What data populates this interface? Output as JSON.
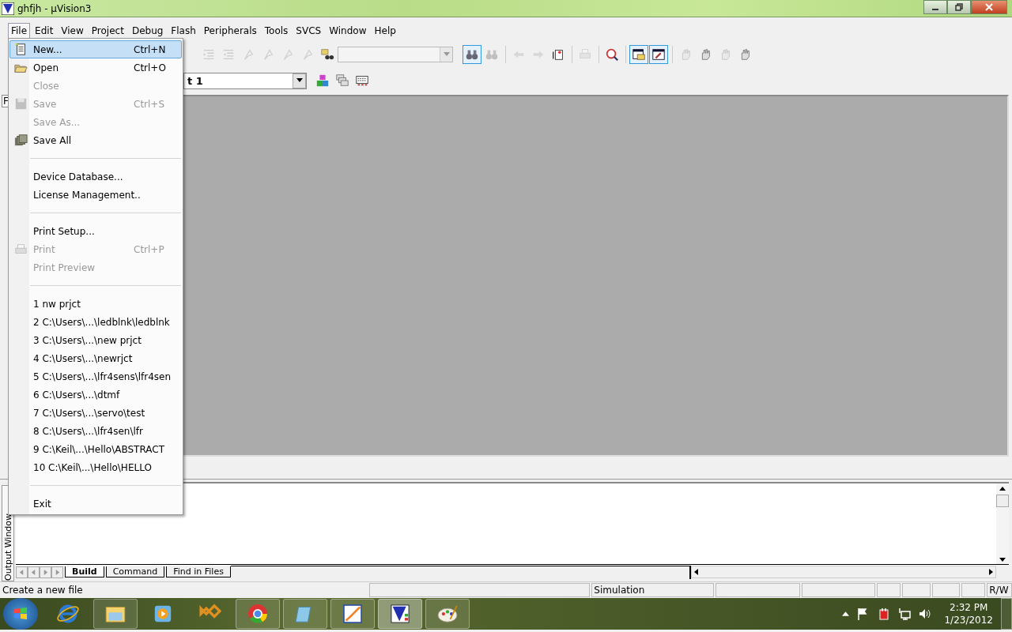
{
  "window": {
    "title": "ghfjh  - µVision3"
  },
  "menubar": [
    {
      "label": "File",
      "selected": true
    },
    {
      "label": "Edit",
      "selected": false
    },
    {
      "label": "View",
      "selected": false
    },
    {
      "label": "Project",
      "selected": false
    },
    {
      "label": "Debug",
      "selected": false
    },
    {
      "label": "Flash",
      "selected": false
    },
    {
      "label": "Peripherals",
      "selected": false
    },
    {
      "label": "Tools",
      "selected": false
    },
    {
      "label": "SVCS",
      "selected": false
    },
    {
      "label": "Window",
      "selected": false
    },
    {
      "label": "Help",
      "selected": false
    }
  ],
  "toolbar": [
    {
      "kind": "indent",
      "disabled": true,
      "selected": false
    },
    {
      "kind": "unindent",
      "disabled": true,
      "selected": false
    },
    {
      "kind": "bookmark",
      "disabled": true,
      "selected": false
    },
    {
      "kind": "bookmark",
      "disabled": true,
      "selected": false
    },
    {
      "kind": "bookmark",
      "disabled": true,
      "selected": false
    },
    {
      "kind": "bookmark",
      "disabled": true,
      "selected": false
    },
    {
      "kind": "findfiles",
      "disabled": false,
      "selected": false
    },
    {
      "kind": "combo",
      "disabled": true
    },
    {
      "kind": "find",
      "disabled": false,
      "selected": true
    },
    {
      "kind": "find",
      "disabled": true,
      "selected": false
    },
    {
      "kind": "back",
      "disabled": true,
      "selected": false
    },
    {
      "kind": "forward",
      "disabled": true,
      "selected": false
    },
    {
      "kind": "browse",
      "disabled": false,
      "selected": false
    },
    {
      "kind": "print",
      "disabled": true,
      "selected": false
    },
    {
      "kind": "debug",
      "disabled": false,
      "selected": false
    },
    {
      "kind": "window",
      "disabled": false,
      "selected": true
    },
    {
      "kind": "build",
      "disabled": false,
      "selected": true
    },
    {
      "kind": "hand",
      "disabled": true,
      "selected": false
    },
    {
      "kind": "hand",
      "disabled": false,
      "selected": false
    },
    {
      "kind": "hand",
      "disabled": true,
      "selected": false
    },
    {
      "kind": "hand",
      "disabled": false,
      "selected": false
    }
  ],
  "target_combo": {
    "value": "t 1"
  },
  "workspace_tab": "F",
  "file_menu": [
    {
      "kind": "item",
      "label": "New...",
      "shortcut": "Ctrl+N",
      "disabled": false,
      "selected": true
    },
    {
      "kind": "item",
      "label": "Open",
      "shortcut": "Ctrl+O",
      "disabled": false,
      "selected": false
    },
    {
      "kind": "item",
      "label": "Close",
      "disabled": true,
      "selected": false
    },
    {
      "kind": "item",
      "label": "Save",
      "shortcut": "Ctrl+S",
      "disabled": true,
      "selected": false
    },
    {
      "kind": "item",
      "label": "Save As...",
      "disabled": true,
      "selected": false
    },
    {
      "kind": "item",
      "label": "Save All",
      "disabled": false,
      "selected": false
    },
    {
      "kind": "separator"
    },
    {
      "kind": "item",
      "label": "Device Database...",
      "disabled": false,
      "selected": false
    },
    {
      "kind": "item",
      "label": "License Management..",
      "disabled": false,
      "selected": false
    },
    {
      "kind": "separator"
    },
    {
      "kind": "item",
      "label": "Print Setup...",
      "disabled": false,
      "selected": false
    },
    {
      "kind": "item",
      "label": "Print",
      "shortcut": "Ctrl+P",
      "disabled": true,
      "selected": false
    },
    {
      "kind": "item",
      "label": "Print Preview",
      "disabled": true,
      "selected": false
    },
    {
      "kind": "separator"
    },
    {
      "kind": "item",
      "label": "1 nw prjct",
      "disabled": false,
      "selected": false
    },
    {
      "kind": "item",
      "label": "2 C:\\Users\\...\\ledblnk\\ledblnk",
      "disabled": false,
      "selected": false
    },
    {
      "kind": "item",
      "label": "3 C:\\Users\\...\\new prjct",
      "disabled": false,
      "selected": false
    },
    {
      "kind": "item",
      "label": "4 C:\\Users\\...\\newrjct",
      "disabled": false,
      "selected": false
    },
    {
      "kind": "item",
      "label": "5 C:\\Users\\...\\lfr4sens\\lfr4sen",
      "disabled": false,
      "selected": false
    },
    {
      "kind": "item",
      "label": "6 C:\\Users\\...\\dtmf",
      "disabled": false,
      "selected": false
    },
    {
      "kind": "item",
      "label": "7 C:\\Users\\...\\servo\\test",
      "disabled": false,
      "selected": false
    },
    {
      "kind": "item",
      "label": "8 C:\\Users\\...\\lfr4sen\\lfr",
      "disabled": false,
      "selected": false
    },
    {
      "kind": "item",
      "label": "9 C:\\Keil\\...\\Hello\\ABSTRACT",
      "disabled": false,
      "selected": false
    },
    {
      "kind": "item",
      "label": "10 C:\\Keil\\...\\Hello\\HELLO",
      "disabled": false,
      "selected": false
    },
    {
      "kind": "separator"
    },
    {
      "kind": "item",
      "label": "Exit",
      "disabled": false,
      "selected": false
    }
  ],
  "output_window": {
    "title": "Output Window",
    "tabs": [
      {
        "label": "Build",
        "selected": true
      },
      {
        "label": "Command",
        "selected": false
      },
      {
        "label": "Find in Files",
        "selected": false
      }
    ]
  },
  "status_bar": {
    "message": "Create a new file",
    "mode": "Simulation",
    "access": "R/W"
  },
  "taskbar": {
    "apps": [
      {
        "kind": "ie",
        "running": false,
        "selected": false
      },
      {
        "kind": "folder",
        "running": true,
        "selected": false
      },
      {
        "kind": "media",
        "running": false,
        "selected": false
      },
      {
        "kind": "studio",
        "running": false,
        "selected": false
      },
      {
        "kind": "chrome",
        "running": true,
        "selected": false
      },
      {
        "kind": "notepad",
        "running": true,
        "selected": false
      },
      {
        "kind": "chart",
        "running": true,
        "selected": false
      },
      {
        "kind": "keil",
        "running": true,
        "selected": true
      },
      {
        "kind": "paint",
        "running": true,
        "selected": false
      }
    ],
    "time": "2:32 PM",
    "date": "1/23/2012"
  }
}
